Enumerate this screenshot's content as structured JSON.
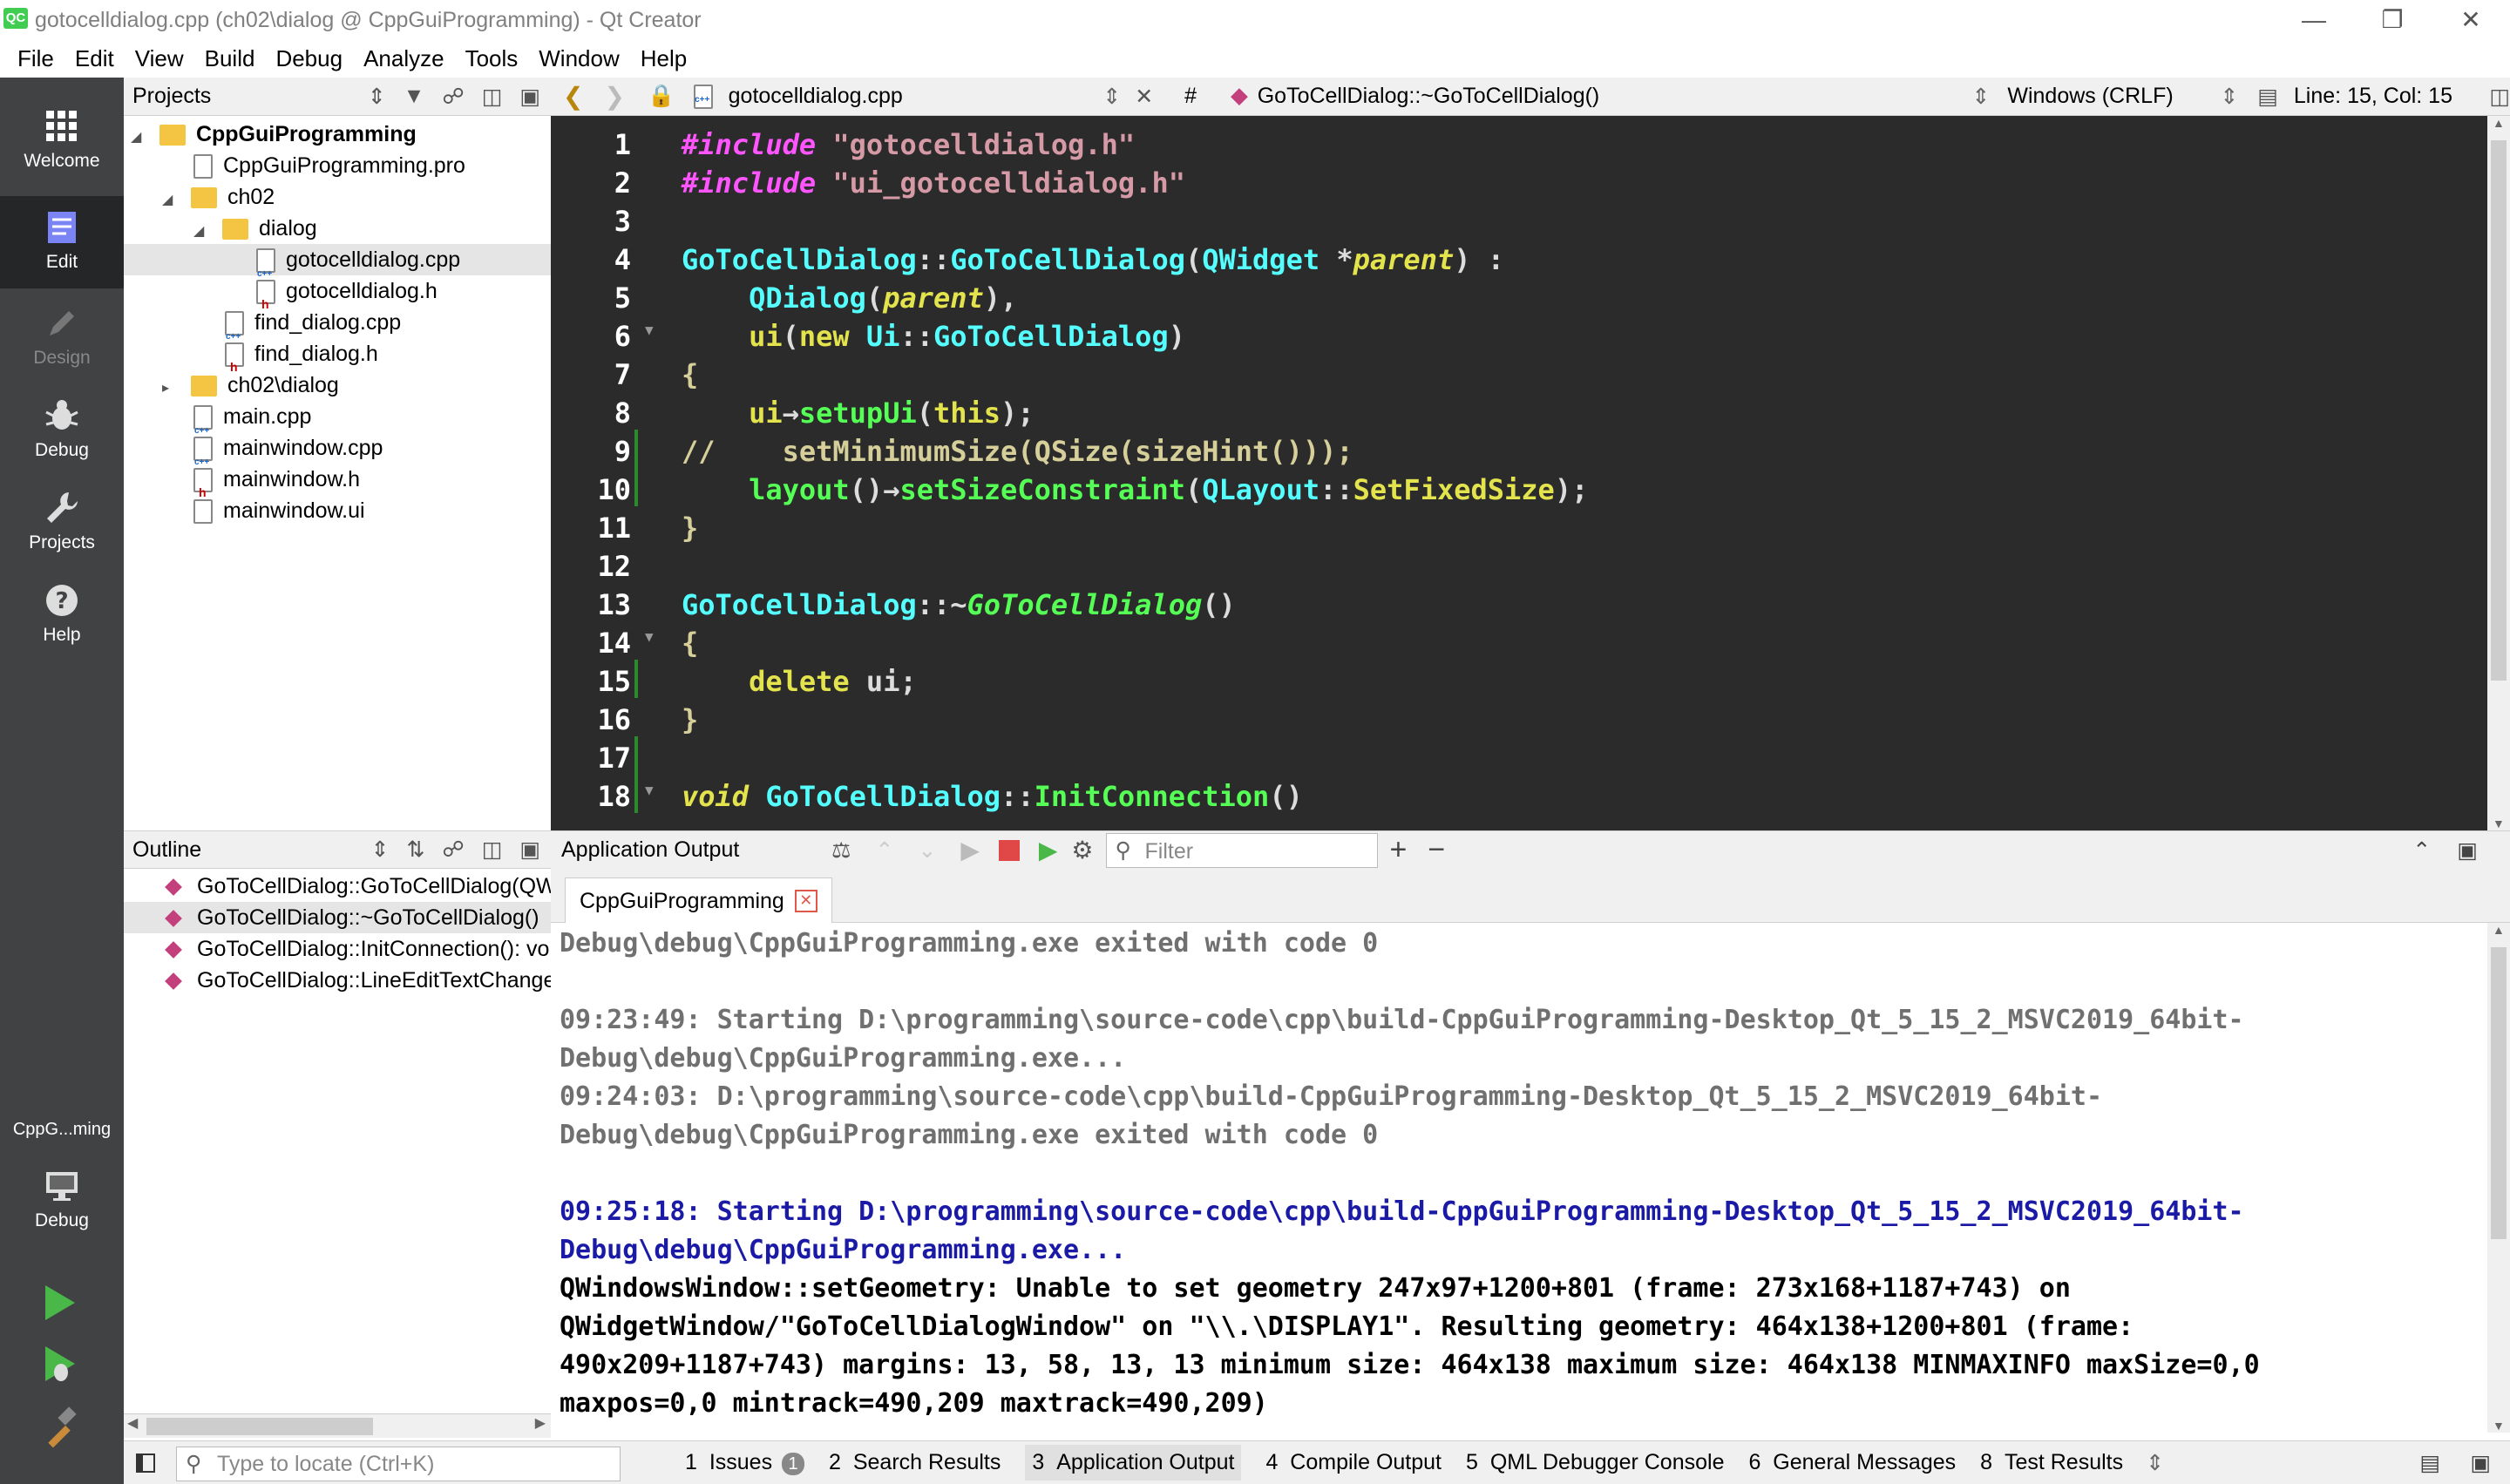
{
  "window": {
    "title": "gotocelldialog.cpp (ch02\\dialog @ CppGuiProgramming) - Qt Creator",
    "app_icon": "QC"
  },
  "menu": [
    "File",
    "Edit",
    "View",
    "Build",
    "Debug",
    "Analyze",
    "Tools",
    "Window",
    "Help"
  ],
  "modes": [
    {
      "label": "Welcome",
      "icon": "grid-icon"
    },
    {
      "label": "Edit",
      "icon": "document-icon"
    },
    {
      "label": "Design",
      "icon": "pencil-icon"
    },
    {
      "label": "Debug",
      "icon": "bug-icon"
    },
    {
      "label": "Projects",
      "icon": "wrench-icon"
    },
    {
      "label": "Help",
      "icon": "help-icon"
    }
  ],
  "kit": {
    "project": "CppG...ming",
    "build": "Debug"
  },
  "projects": {
    "header": "Projects",
    "tree": [
      {
        "label": "CppGuiProgramming",
        "kind": "project",
        "depth": 0,
        "expanded": true
      },
      {
        "label": "CppGuiProgramming.pro",
        "kind": "pro",
        "depth": 1
      },
      {
        "label": "ch02",
        "kind": "folder",
        "depth": 1,
        "expanded": true
      },
      {
        "label": "dialog",
        "kind": "folder",
        "depth": 2,
        "expanded": true
      },
      {
        "label": "gotocelldialog.cpp",
        "kind": "cpp",
        "depth": 3,
        "selected": true
      },
      {
        "label": "gotocelldialog.h",
        "kind": "h",
        "depth": 3
      },
      {
        "label": "find_dialog.cpp",
        "kind": "cpp",
        "depth": 2
      },
      {
        "label": "find_dialog.h",
        "kind": "h",
        "depth": 2
      },
      {
        "label": "ch02\\dialog",
        "kind": "folder",
        "depth": 1,
        "expanded": false
      },
      {
        "label": "main.cpp",
        "kind": "cpp",
        "depth": 1
      },
      {
        "label": "mainwindow.cpp",
        "kind": "cpp",
        "depth": 1
      },
      {
        "label": "mainwindow.h",
        "kind": "h",
        "depth": 1
      },
      {
        "label": "mainwindow.ui",
        "kind": "ui",
        "depth": 1
      }
    ]
  },
  "outline": {
    "header": "Outline",
    "items": [
      "GoToCellDialog::GoToCellDialog(QW",
      "GoToCellDialog::~GoToCellDialog()",
      "GoToCellDialog::InitConnection(): vo",
      "GoToCellDialog::LineEditTextChange"
    ]
  },
  "editor_toolbar": {
    "file": "gotocelldialog.cpp",
    "hash": "#",
    "symbol": "GoToCellDialog::~GoToCellDialog()",
    "line_endings": "Windows (CRLF)",
    "position": "Line: 15, Col: 15"
  },
  "code_lines": [
    "1",
    "2",
    "3",
    "4",
    "5",
    "6",
    "7",
    "8",
    "9",
    "10",
    "11",
    "12",
    "13",
    "14",
    "15",
    "16",
    "17",
    "18"
  ],
  "code": {
    "l1a": "#include",
    "l1b": " \"gotocelldialog.h\"",
    "l2a": "#include",
    "l2b": " \"ui_gotocelldialog.h\"",
    "l4a": "GoToCellDialog",
    "l4b": "::",
    "l4c": "GoToCellDialog",
    "l4d": "(",
    "l4e": "QWidget",
    "l4f": " *",
    "l4g": "parent",
    "l4h": ") :",
    "l5a": "    ",
    "l5b": "QDialog",
    "l5c": "(",
    "l5d": "parent",
    "l5e": "),",
    "l6a": "    ",
    "l6b": "ui",
    "l6c": "(",
    "l6d": "new",
    "l6e": " ",
    "l6f": "Ui",
    "l6g": "::",
    "l6h": "GoToCellDialog",
    "l6i": ")",
    "l7": "{",
    "l8a": "    ",
    "l8b": "ui",
    "l8c": "→",
    "l8d": "setupUi",
    "l8e": "(",
    "l8f": "this",
    "l8g": ");",
    "l9": "//    setMinimumSize(QSize(sizeHint()));",
    "l10a": "    ",
    "l10b": "layout",
    "l10c": "()→",
    "l10d": "setSizeConstraint",
    "l10e": "(",
    "l10f": "QLayout",
    "l10g": "::",
    "l10h": "SetFixedSize",
    "l10i": ");",
    "l11": "}",
    "l13a": "GoToCellDialog",
    "l13b": "::~",
    "l13c": "GoToCellDialog",
    "l13d": "()",
    "l14": "{",
    "l15a": "    ",
    "l15b": "delete",
    "l15c": " ui;",
    "l16": "}",
    "l18a": "void",
    "l18b": " ",
    "l18c": "GoToCellDialog",
    "l18d": "::",
    "l18e": "InitConnection",
    "l18f": "()"
  },
  "output_pane": {
    "header": "Application Output",
    "filter_placeholder": "Filter",
    "tab": "CppGuiProgramming",
    "lines": [
      {
        "text": "Debug\\debug\\CppGuiProgramming.exe exited with code 0",
        "color": "gray"
      },
      {
        "text": "",
        "color": "gray"
      },
      {
        "text": "09:23:49: Starting D:\\programming\\source-code\\cpp\\build-CppGuiProgramming-Desktop_Qt_5_15_2_MSVC2019_64bit-",
        "color": "gray"
      },
      {
        "text": "Debug\\debug\\CppGuiProgramming.exe...",
        "color": "gray"
      },
      {
        "text": "09:24:03: D:\\programming\\source-code\\cpp\\build-CppGuiProgramming-Desktop_Qt_5_15_2_MSVC2019_64bit-",
        "color": "gray"
      },
      {
        "text": "Debug\\debug\\CppGuiProgramming.exe exited with code 0",
        "color": "gray"
      },
      {
        "text": "",
        "color": "gray"
      },
      {
        "text": "09:25:18: Starting D:\\programming\\source-code\\cpp\\build-CppGuiProgramming-Desktop_Qt_5_15_2_MSVC2019_64bit-",
        "color": "blue"
      },
      {
        "text": "Debug\\debug\\CppGuiProgramming.exe...",
        "color": "blue"
      },
      {
        "text": "QWindowsWindow::setGeometry: Unable to set geometry 247x97+1200+801 (frame: 273x168+1187+743) on",
        "color": "blk"
      },
      {
        "text": "QWidgetWindow/\"GoToCellDialogWindow\" on \"\\\\.\\DISPLAY1\". Resulting geometry: 464x138+1200+801 (frame:",
        "color": "blk"
      },
      {
        "text": "490x209+1187+743) margins: 13, 58, 13, 13 minimum size: 464x138 maximum size: 464x138 MINMAXINFO maxSize=0,0",
        "color": "blk"
      },
      {
        "text": "maxpos=0,0 mintrack=490,209 maxtrack=490,209)",
        "color": "blk"
      }
    ]
  },
  "statusbar": {
    "locate_placeholder": "Type to locate (Ctrl+K)",
    "tabs": [
      {
        "num": "1",
        "label": "Issues",
        "badge": "1"
      },
      {
        "num": "2",
        "label": "Search Results"
      },
      {
        "num": "3",
        "label": "Application Output",
        "active": true
      },
      {
        "num": "4",
        "label": "Compile Output"
      },
      {
        "num": "5",
        "label": "QML Debugger Console"
      },
      {
        "num": "6",
        "label": "General Messages"
      },
      {
        "num": "8",
        "label": "Test Results"
      }
    ]
  }
}
